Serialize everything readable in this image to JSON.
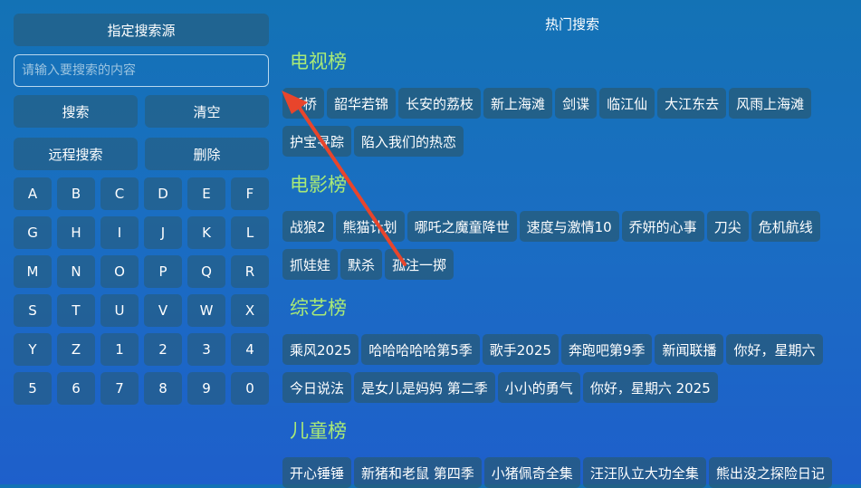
{
  "left": {
    "source_button": "指定搜索源",
    "search_placeholder": "请输入要搜索的内容",
    "search_button": "搜索",
    "clear_button": "清空",
    "remote_button": "远程搜索",
    "delete_button": "删除",
    "keys": [
      "A",
      "B",
      "C",
      "D",
      "E",
      "F",
      "G",
      "H",
      "I",
      "J",
      "K",
      "L",
      "M",
      "N",
      "O",
      "P",
      "Q",
      "R",
      "S",
      "T",
      "U",
      "V",
      "W",
      "X",
      "Y",
      "Z",
      "1",
      "2",
      "3",
      "4",
      "5",
      "6",
      "7",
      "8",
      "9",
      "0"
    ]
  },
  "hot": {
    "title": "热门搜索",
    "sections": [
      {
        "title": "电视榜",
        "rows": [
          [
            "断桥",
            "韶华若锦",
            "长安的荔枝",
            "新上海滩",
            "剑谍",
            "临江仙",
            "大江东去",
            "风雨上海滩"
          ],
          [
            "护宝寻踪",
            "陷入我们的热恋"
          ]
        ]
      },
      {
        "title": "电影榜",
        "rows": [
          [
            "战狼2",
            "熊猫计划",
            "哪吒之魔童降世",
            "速度与激情10",
            "乔妍的心事",
            "刀尖",
            "危机航线"
          ],
          [
            "抓娃娃",
            "默杀",
            "孤注一掷"
          ]
        ]
      },
      {
        "title": "综艺榜",
        "rows": [
          [
            "乘风2025",
            "哈哈哈哈哈第5季",
            "歌手2025",
            "奔跑吧第9季",
            "新闻联播",
            "你好，星期六"
          ],
          [
            "今日说法",
            "是女儿是妈妈 第二季",
            "小小的勇气",
            "你好，星期六 2025"
          ]
        ]
      },
      {
        "title": "儿童榜",
        "rows": [
          [
            "开心锤锤",
            "新猪和老鼠 第四季",
            "小猪佩奇全集",
            "汪汪队立大功全集",
            "熊出没之探险日记"
          ]
        ]
      }
    ]
  },
  "colors": {
    "accent": "#a9ea76",
    "arrow": "#e8452c"
  }
}
